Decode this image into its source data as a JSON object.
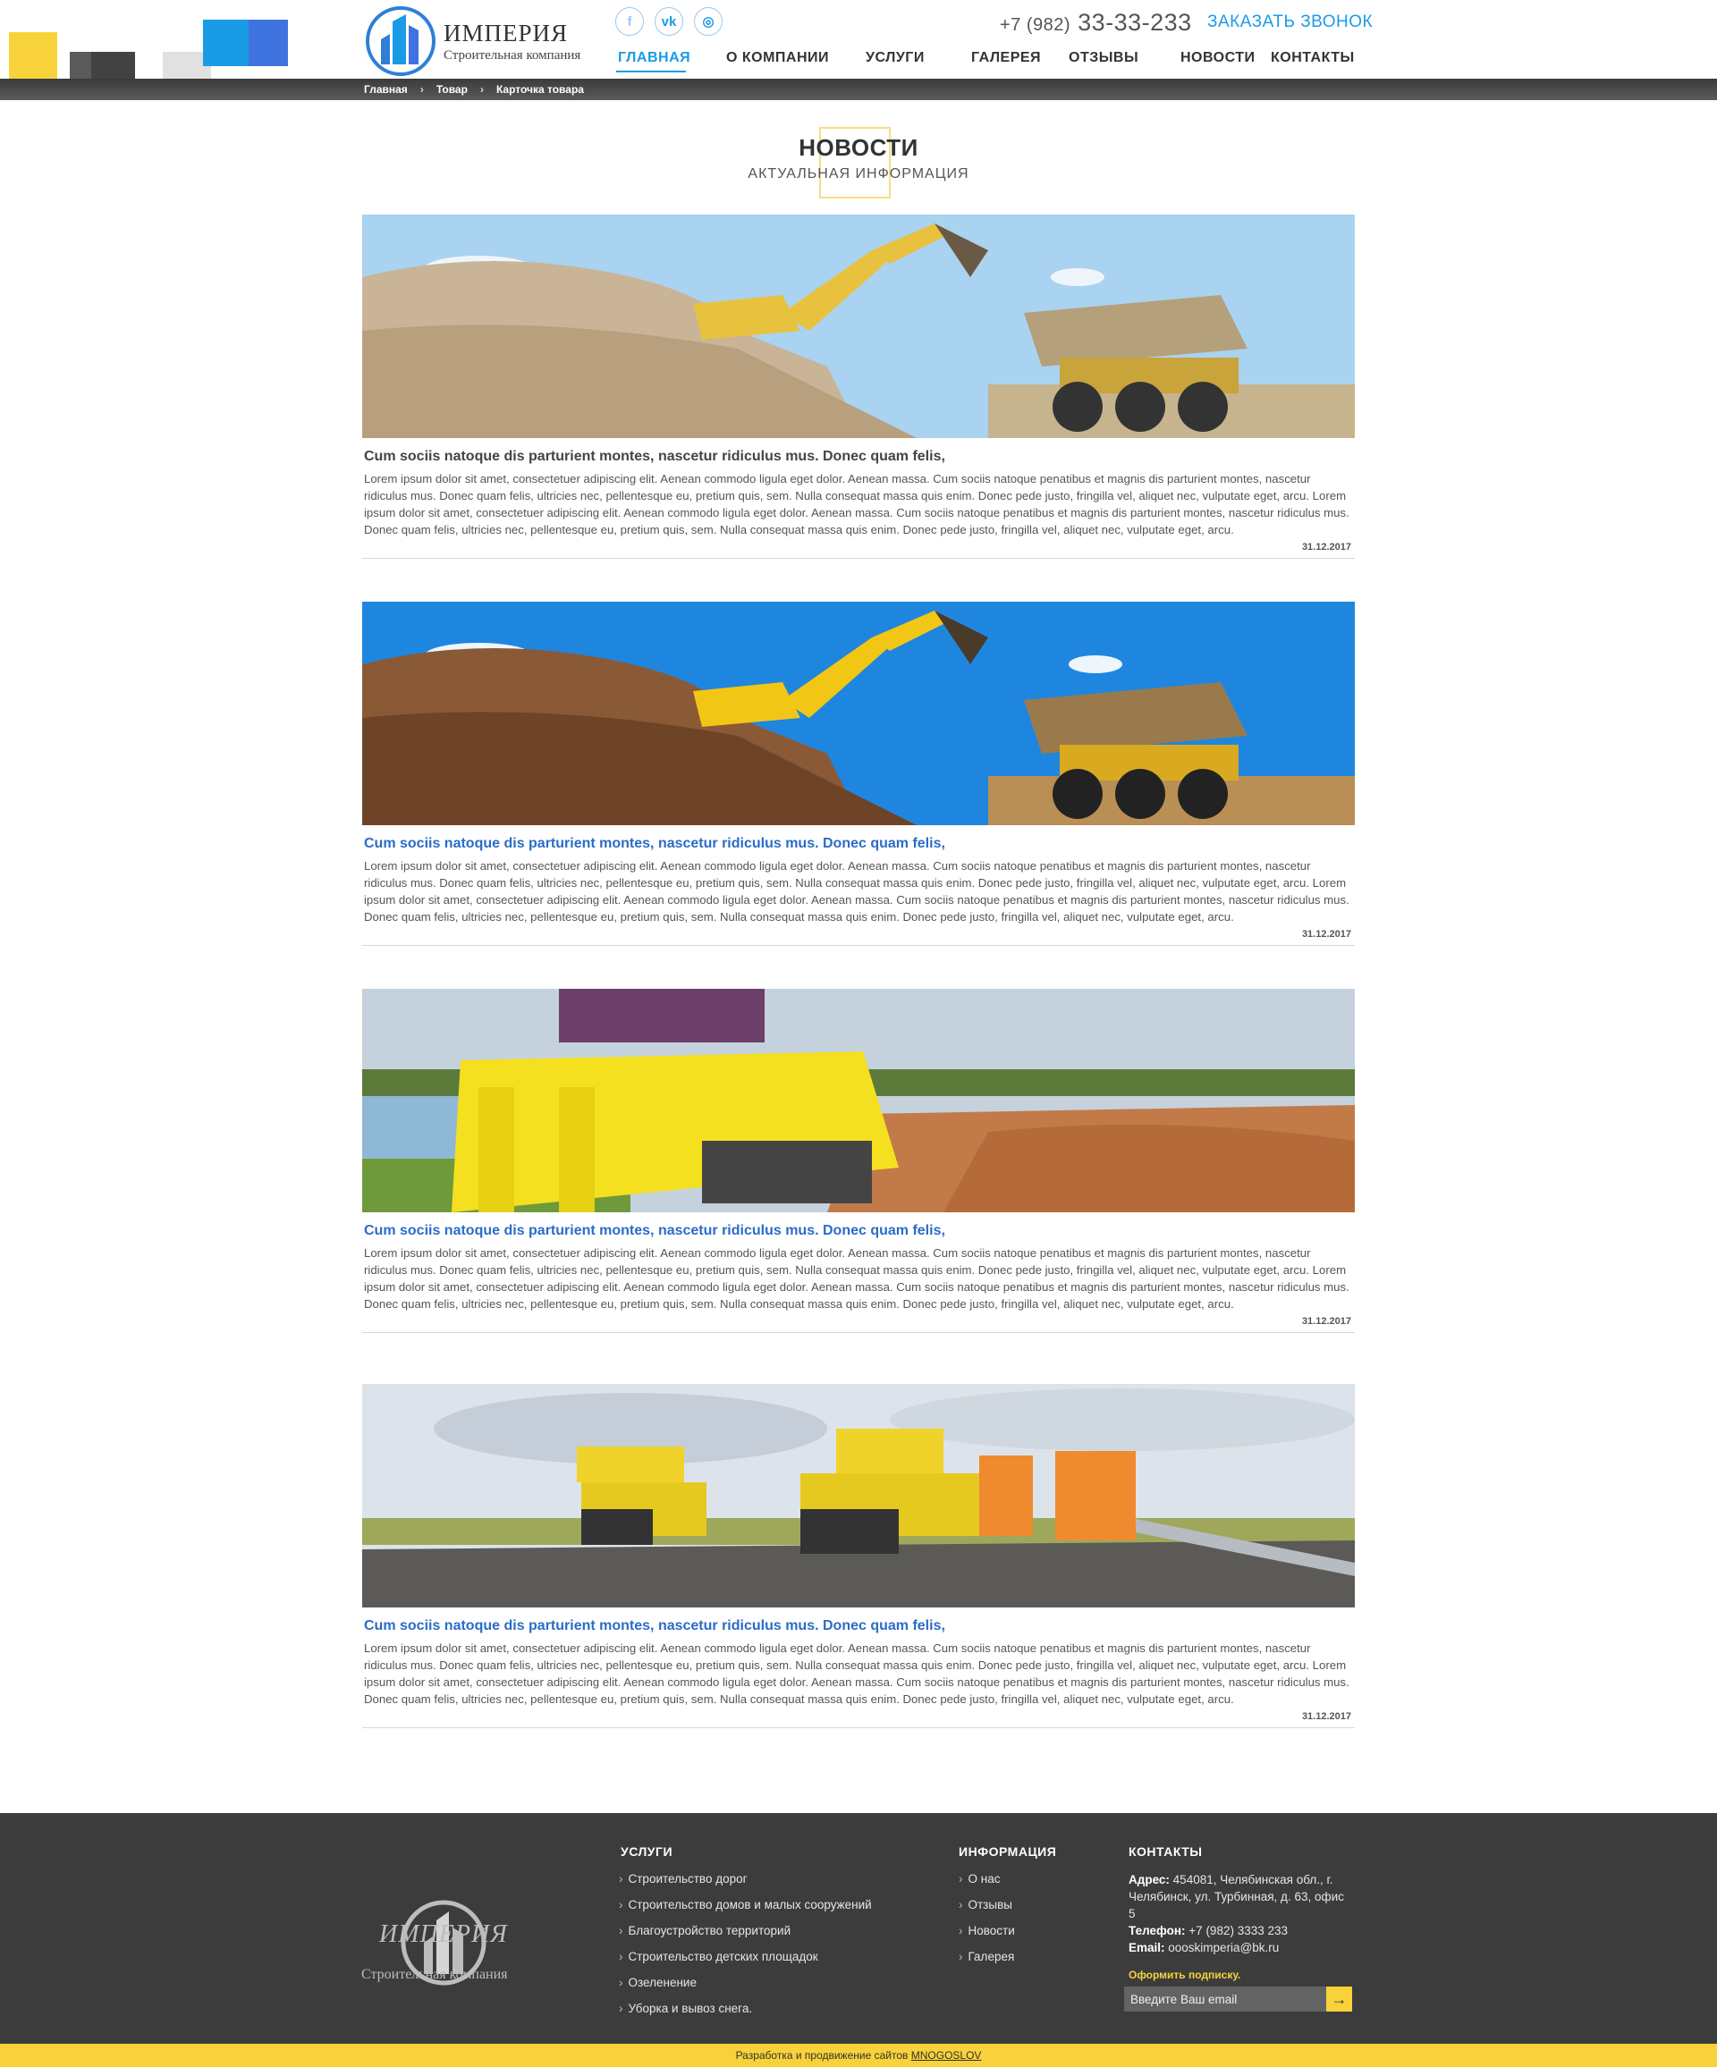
{
  "palette": {
    "yellow": "#f8d23a",
    "dark": "#424242",
    "light": "#e1e1e1",
    "blue": "#1a9be6",
    "blue2": "#3f74e0"
  },
  "brand": {
    "title": "ИМПЕРИЯ",
    "subtitle": "Строительная компания"
  },
  "socials": [
    {
      "icon": "facebook-icon",
      "glyph": "f"
    },
    {
      "icon": "vk-icon",
      "glyph": "vk"
    },
    {
      "icon": "instagram-icon",
      "glyph": "◎"
    }
  ],
  "phone": {
    "prefix": "+7 (982)",
    "number": "33-33-233"
  },
  "callback_label": "ЗАКАЗАТЬ ЗВОНОК",
  "nav": [
    "ГЛАВНАЯ",
    "О КОМПАНИИ",
    "УСЛУГИ",
    "ГАЛЕРЕЯ",
    "ОТЗЫВЫ",
    "НОВОСТИ",
    "КОНТАКТЫ"
  ],
  "breadcrumbs": [
    "Главная",
    "Товар",
    "Карточка товара"
  ],
  "section": {
    "title": "НОВОСТИ",
    "subtitle": "АКТУАЛЬНАЯ ИНФОРМАЦИЯ"
  },
  "news": [
    {
      "title": "Cum sociis natoque dis parturient montes, nascetur ridiculus mus. Donec quam felis,",
      "text": "Lorem ipsum dolor sit amet, consectetuer adipiscing elit. Aenean commodo ligula eget dolor. Aenean massa. Cum sociis natoque penatibus et magnis dis parturient montes, nascetur ridiculus mus. Donec quam felis, ultricies nec, pellentesque eu, pretium quis, sem. Nulla consequat massa quis enim. Donec pede justo, fringilla vel, aliquet nec, vulputate eget, arcu. Lorem ipsum dolor sit amet, consectetuer adipiscing elit. Aenean commodo ligula eget dolor. Aenean massa. Cum sociis natoque penatibus et magnis dis parturient montes, nascetur ridiculus mus. Donec quam felis, ultricies nec, pellentesque eu, pretium quis, sem. Nulla consequat massa quis enim. Donec pede justo, fringilla vel, aliquet nec, vulputate eget, arcu.",
      "date": "31.12.2017"
    },
    {
      "title": "Cum sociis natoque dis parturient montes, nascetur ridiculus mus. Donec quam felis,",
      "text": "Lorem ipsum dolor sit amet, consectetuer adipiscing elit. Aenean commodo ligula eget dolor. Aenean massa. Cum sociis natoque penatibus et magnis dis parturient montes, nascetur ridiculus mus. Donec quam felis, ultricies nec, pellentesque eu, pretium quis, sem. Nulla consequat massa quis enim. Donec pede justo, fringilla vel, aliquet nec, vulputate eget, arcu. Lorem ipsum dolor sit amet, consectetuer adipiscing elit. Aenean commodo ligula eget dolor. Aenean massa. Cum sociis natoque penatibus et magnis dis parturient montes, nascetur ridiculus mus. Donec quam felis, ultricies nec, pellentesque eu, pretium quis, sem. Nulla consequat massa quis enim. Donec pede justo, fringilla vel, aliquet nec, vulputate eget, arcu.",
      "date": "31.12.2017"
    },
    {
      "title": "Cum sociis natoque dis parturient montes, nascetur ridiculus mus. Donec quam felis,",
      "text": "Lorem ipsum dolor sit amet, consectetuer adipiscing elit. Aenean commodo ligula eget dolor. Aenean massa. Cum sociis natoque penatibus et magnis dis parturient montes, nascetur ridiculus mus. Donec quam felis, ultricies nec, pellentesque eu, pretium quis, sem. Nulla consequat massa quis enim. Donec pede justo, fringilla vel, aliquet nec, vulputate eget, arcu. Lorem ipsum dolor sit amet, consectetuer adipiscing elit. Aenean commodo ligula eget dolor. Aenean massa. Cum sociis natoque penatibus et magnis dis parturient montes, nascetur ridiculus mus. Donec quam felis, ultricies nec, pellentesque eu, pretium quis, sem. Nulla consequat massa quis enim. Donec pede justo, fringilla vel, aliquet nec, vulputate eget, arcu.",
      "date": "31.12.2017"
    },
    {
      "title": "Cum sociis natoque dis parturient montes, nascetur ridiculus mus. Donec quam felis,",
      "text": "Lorem ipsum dolor sit amet, consectetuer adipiscing elit. Aenean commodo ligula eget dolor. Aenean massa. Cum sociis natoque penatibus et magnis dis parturient montes, nascetur ridiculus mus. Donec quam felis, ultricies nec, pellentesque eu, pretium quis, sem. Nulla consequat massa quis enim. Donec pede justo, fringilla vel, aliquet nec, vulputate eget, arcu. Lorem ipsum dolor sit amet, consectetuer adipiscing elit. Aenean commodo ligula eget dolor. Aenean massa. Cum sociis natoque penatibus et magnis dis parturient montes, nascetur ridiculus mus. Donec quam felis, ultricies nec, pellentesque eu, pretium quis, sem. Nulla consequat massa quis enim. Donec pede justo, fringilla vel, aliquet nec, vulputate eget, arcu.",
      "date": "31.12.2017"
    }
  ],
  "footer": {
    "brand_title": "ИМПЕРИЯ",
    "brand_subtitle": "Строительная компания",
    "services_title": "УСЛУГИ",
    "services": [
      "Строительство дорог",
      "Строительство домов и малых сооружений",
      "Благоустройство территорий",
      "Строительство детских площадок",
      "Озеленение",
      "Уборка и вывоз снега."
    ],
    "info_title": "ИНФОРМАЦИЯ",
    "info": [
      "О нас",
      "Отзывы",
      "Новости",
      "Галерея"
    ],
    "contacts_title": "КОНТАКТЫ",
    "address_label": "Адрес:",
    "address": "454081, Челябинская обл., г. Челябинск, ул. Турбинная, д. 63, офис 5",
    "phone_label": "Телефон:",
    "phone": "+7 (982) 3333 233",
    "email_label": "Email:",
    "email": "oooskimperia@bk.ru",
    "subscribe_label": "Оформить подписку.",
    "subscribe_placeholder": "Введите Ваш email",
    "dev_text": "Разработка и продвижение сайтов",
    "dev_brand": "MNOGOSLOV"
  }
}
